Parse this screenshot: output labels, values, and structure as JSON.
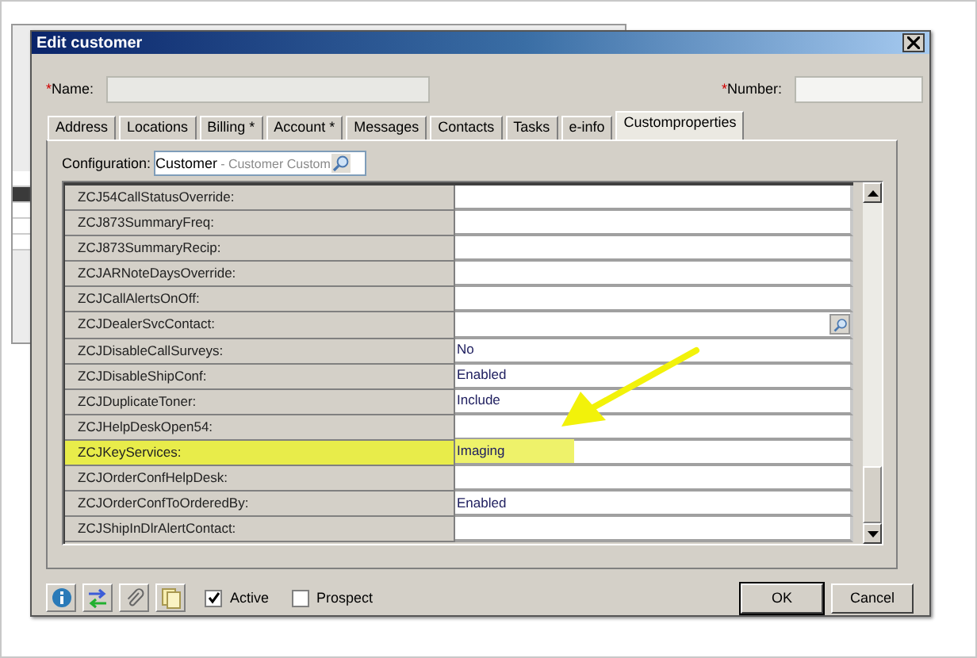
{
  "window": {
    "title": "Edit customer"
  },
  "header": {
    "name_label": "Name:",
    "number_label": "Number:",
    "required_mark": "*"
  },
  "tabs": [
    {
      "label": "Address",
      "selected": false
    },
    {
      "label": "Locations",
      "selected": false
    },
    {
      "label": "Billing *",
      "selected": false
    },
    {
      "label": "Account *",
      "selected": false
    },
    {
      "label": "Messages",
      "selected": false
    },
    {
      "label": "Contacts",
      "selected": false
    },
    {
      "label": "Tasks",
      "selected": false
    },
    {
      "label": "e-info",
      "selected": false
    },
    {
      "label": "Customproperties",
      "selected": true
    }
  ],
  "configuration": {
    "label": "Configuration:",
    "value": "Customer",
    "hint": "- Customer Custom"
  },
  "properties": [
    {
      "label": "ZCJ54CallStatusOverride:",
      "kind": "text",
      "highlighted": false
    },
    {
      "label": "ZCJ873SummaryFreq:",
      "kind": "text",
      "highlighted": false
    },
    {
      "label": "ZCJ873SummaryRecip:",
      "kind": "text",
      "highlighted": false
    },
    {
      "label": "ZCJARNoteDaysOverride:",
      "kind": "text",
      "highlighted": false
    },
    {
      "label": "ZCJCallAlertsOnOff:",
      "kind": "text",
      "highlighted": false
    },
    {
      "label": "ZCJDealerSvcContact:",
      "kind": "lookup",
      "highlighted": false
    },
    {
      "label": "ZCJDisableCallSurveys:",
      "value": "No",
      "kind": "text",
      "highlighted": false
    },
    {
      "label": "ZCJDisableShipConf:",
      "value": "Enabled",
      "kind": "text",
      "highlighted": false
    },
    {
      "label": "ZCJDuplicateToner:",
      "value": "Include",
      "kind": "text",
      "highlighted": false
    },
    {
      "label": "ZCJHelpDeskOpen54:",
      "kind": "text",
      "highlighted": false
    },
    {
      "label": "ZCJKeyServices:",
      "value": "Imaging",
      "kind": "text",
      "highlighted": true
    },
    {
      "label": "ZCJOrderConfHelpDesk:",
      "kind": "text",
      "highlighted": false
    },
    {
      "label": "ZCJOrderConfToOrderedBy:",
      "value": "Enabled",
      "kind": "text",
      "highlighted": false
    },
    {
      "label": "ZCJShipInDlrAlertContact:",
      "kind": "text",
      "highlighted": false
    }
  ],
  "footer": {
    "checkboxes": [
      {
        "label": "Active",
        "checked": true
      },
      {
        "label": "Prospect",
        "checked": false
      }
    ],
    "buttons": [
      "OK",
      "Cancel"
    ]
  }
}
